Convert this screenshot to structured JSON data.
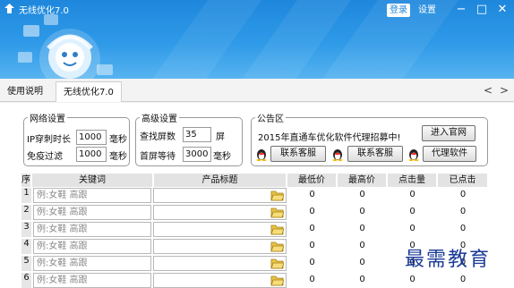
{
  "app": {
    "title": "无线优化7.0",
    "login": "登录",
    "settings": "设置"
  },
  "colors": {
    "titlebar": "#1e87dc",
    "header_bg": "#e3e3e3",
    "watermark": "#1a3a96"
  },
  "tabs": {
    "help": "使用说明",
    "main": "无线优化7.0"
  },
  "network": {
    "legend": "网络设置",
    "ip_label": "IP穿刺时长",
    "ip_value": "1000",
    "ip_unit": "毫秒",
    "filter_label": "免疫过滤",
    "filter_value": "1000",
    "filter_unit": "毫秒"
  },
  "advanced": {
    "legend": "高级设置",
    "search_label": "查找屏数",
    "search_value": "35",
    "search_unit": "屏",
    "wait_label": "首屏等待",
    "wait_value": "3000",
    "wait_unit": "毫秒"
  },
  "notice": {
    "legend": "公告区",
    "text": "2015年直通车优化软件代理招募中!",
    "visit": "进入官网",
    "service1": "联系客服",
    "service2": "联系客服",
    "agent": "代理软件"
  },
  "table": {
    "headers": [
      "序",
      "关键词",
      "产品标题",
      "最低价",
      "最高价",
      "点击量",
      "已点击"
    ],
    "rows": [
      {
        "index": "1",
        "keyword": "例:女鞋 高跟",
        "title": "",
        "min": "0",
        "max": "0",
        "clicks": "0",
        "clicked": "0"
      },
      {
        "index": "2",
        "keyword": "例:女鞋 高跟",
        "title": "",
        "min": "0",
        "max": "0",
        "clicks": "0",
        "clicked": "0"
      },
      {
        "index": "3",
        "keyword": "例:女鞋 高跟",
        "title": "",
        "min": "0",
        "max": "0",
        "clicks": "0",
        "clicked": "0"
      },
      {
        "index": "4",
        "keyword": "例:女鞋 高跟",
        "title": "",
        "min": "0",
        "max": "0",
        "clicks": "0",
        "clicked": "0"
      },
      {
        "index": "5",
        "keyword": "例:女鞋 高跟",
        "title": "",
        "min": "0",
        "max": "0",
        "clicks": "0",
        "clicked": "0"
      },
      {
        "index": "6",
        "keyword": "例:女鞋 高跟",
        "title": "",
        "min": "0",
        "max": "0",
        "clicks": "0",
        "clicked": "0"
      }
    ]
  },
  "watermark": "最需教育"
}
